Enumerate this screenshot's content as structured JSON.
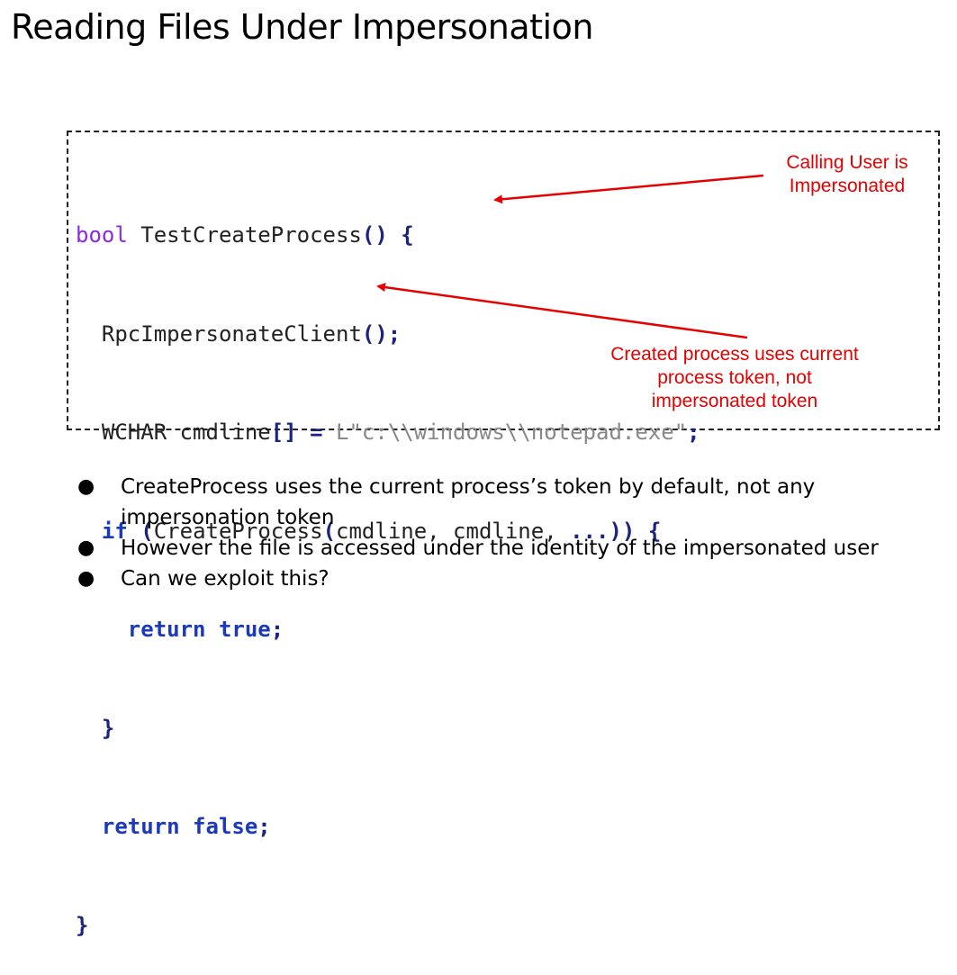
{
  "title": "Reading Files Under Impersonation",
  "code": {
    "line1": {
      "kw": "bool",
      "name": " TestCreateProcess",
      "parens": "()",
      "brace": " {"
    },
    "line2": {
      "indent": "  ",
      "call": "RpcImpersonateClient",
      "parens": "()",
      "semi": ";"
    },
    "line3": {
      "indent": "  ",
      "type": "WCHAR cmdline",
      "brackets": "[]",
      "eq": " = ",
      "str": "L\"c:\\\\windows\\\\notepad.exe\"",
      "semi": ";"
    },
    "line4": {
      "indent": "  ",
      "kw": "if",
      "open": " (",
      "call": "CreateProcess",
      "paren": "(",
      "args": "cmdline, cmdline, ",
      "dots": "...",
      "close": ")) {"
    },
    "line5": {
      "indent": "    ",
      "kw": "return true",
      "semi": ";"
    },
    "line6": {
      "indent": "  ",
      "brace": "}"
    },
    "line7": {
      "indent": "  ",
      "kw": "return false",
      "semi": ";"
    },
    "line8": {
      "brace": "}"
    }
  },
  "callouts": {
    "impersonated": [
      "Calling User is",
      "Impersonated"
    ],
    "token": [
      "Created process uses current",
      "process token, not",
      "impersonated token"
    ]
  },
  "bullets": [
    {
      "line1": "CreateProcess uses the current process’s token by default, not any",
      "line2": "impersonation token"
    },
    {
      "line1": "However the file is accessed under the identity of the impersonated user"
    },
    {
      "line1": "Can we exploit this?"
    }
  ],
  "bullet_symbol": "●",
  "colors": {
    "callout": "#e60000",
    "keyword": "#1c39bb",
    "type_keyword": "#8a2be2",
    "string": "#888888"
  }
}
